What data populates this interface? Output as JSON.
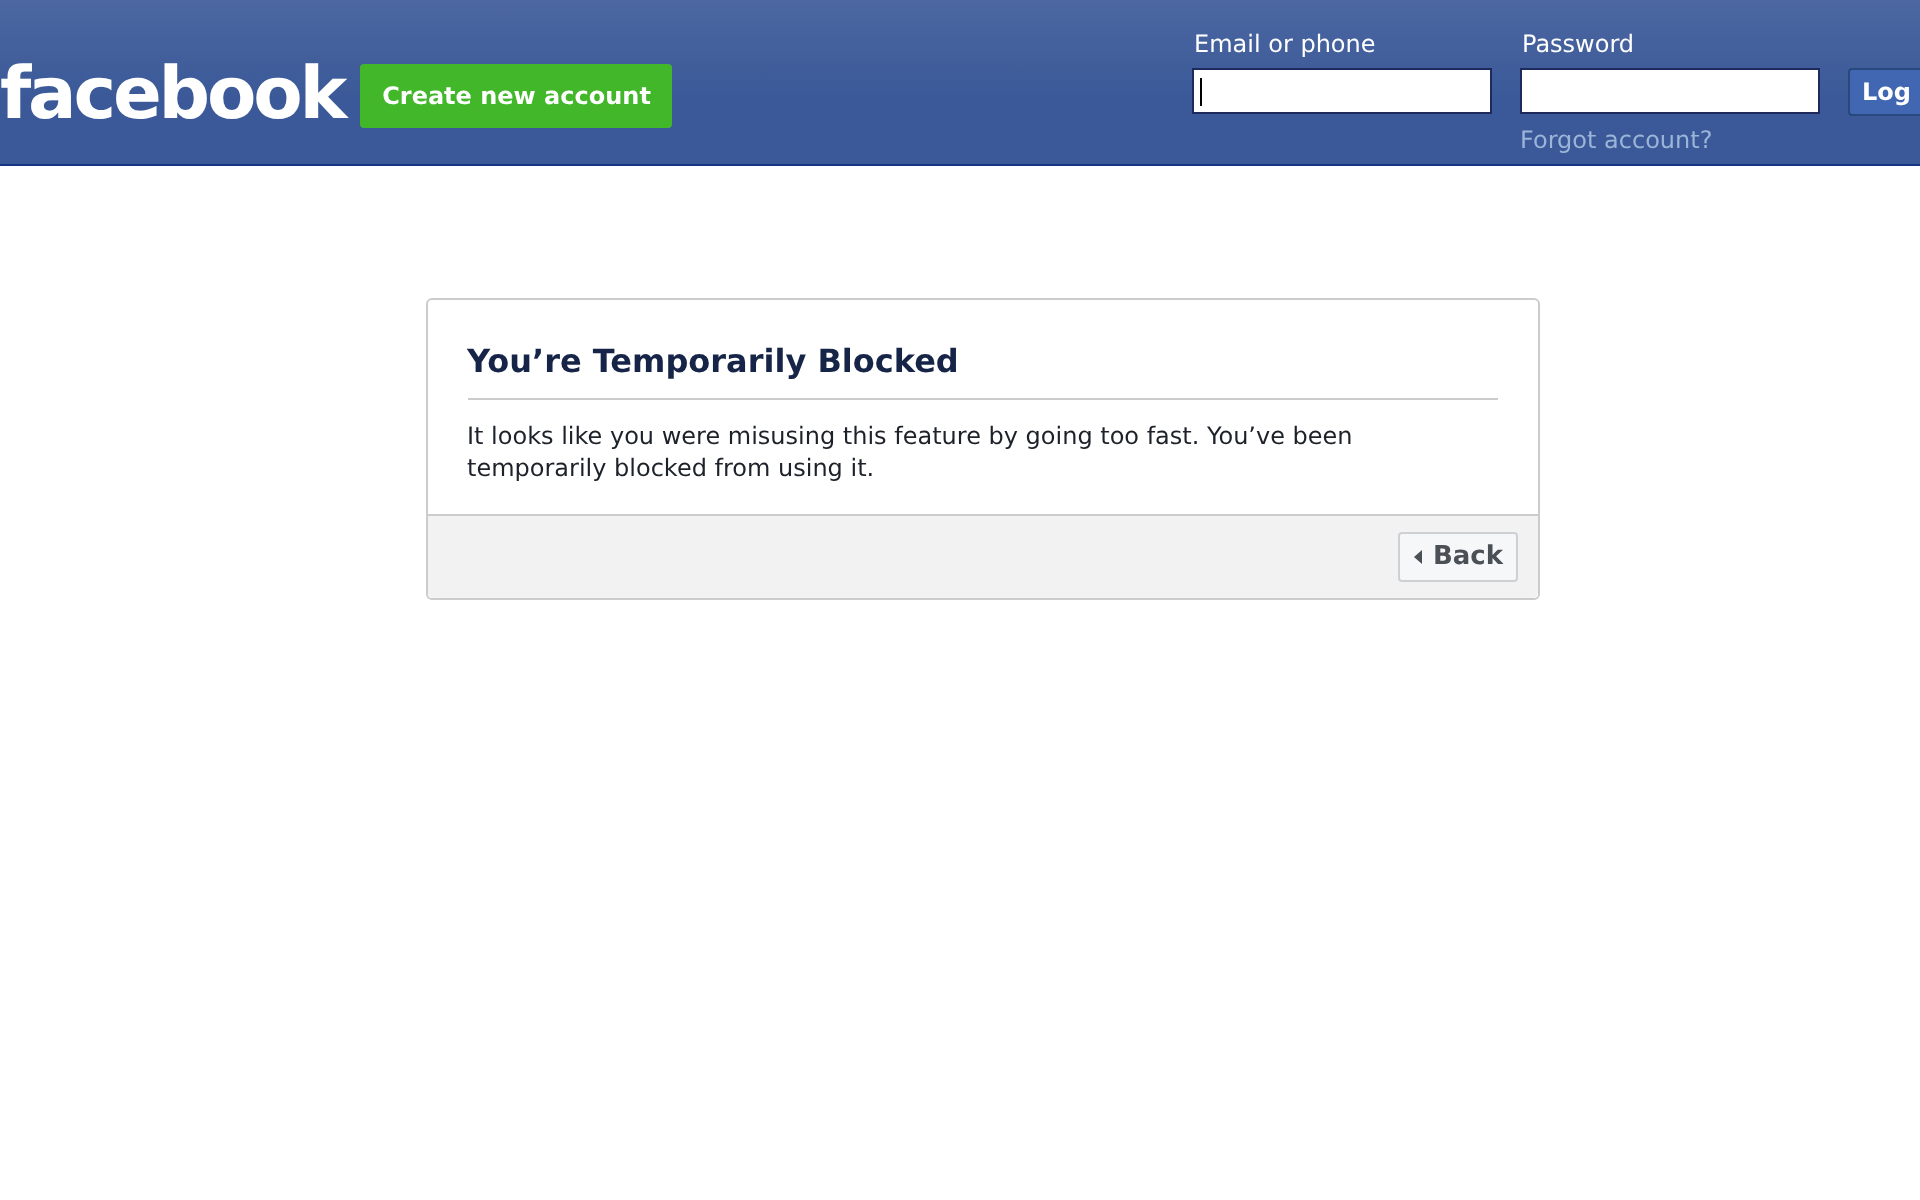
{
  "header": {
    "logo": "facebook",
    "signup_button": "Create new account",
    "login": {
      "email": {
        "label": "Email or phone",
        "focused": true
      },
      "password": {
        "label": "Password",
        "focused": false
      },
      "forgot_link": "Forgot account?",
      "login_button": "Log"
    }
  },
  "dialog": {
    "title": "You’re Temporarily Blocked",
    "message": "It looks like you were misusing this feature by going too fast. You’ve been temporarily blocked from using it.",
    "back_button": "Back"
  }
}
